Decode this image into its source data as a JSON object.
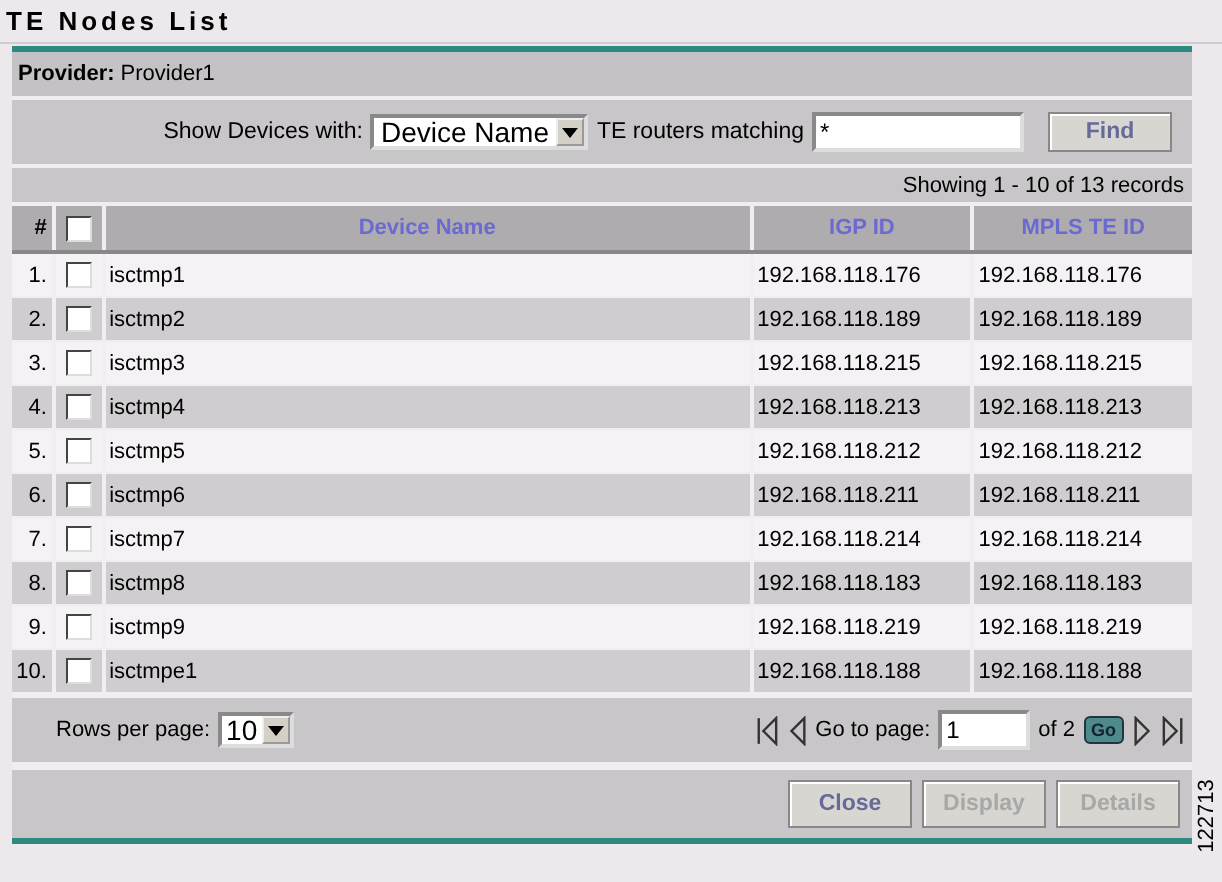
{
  "title": "TE Nodes List",
  "provider": {
    "label": "Provider:",
    "value": "Provider1"
  },
  "filter": {
    "label": "Show Devices with:",
    "select": "Device Name",
    "match_label": "TE routers matching",
    "match_value": "*",
    "button": "Find"
  },
  "records": "Showing 1 - 10 of 13 records",
  "table": {
    "columns": [
      "#",
      "Device Name",
      "IGP ID",
      "MPLS TE ID"
    ],
    "all_checked": false,
    "rows": [
      {
        "num": "1.",
        "checked": false,
        "name": "isctmp1",
        "igp": "192.168.118.176",
        "mpls": "192.168.118.176"
      },
      {
        "num": "2.",
        "checked": false,
        "name": "isctmp2",
        "igp": "192.168.118.189",
        "mpls": "192.168.118.189"
      },
      {
        "num": "3.",
        "checked": false,
        "name": "isctmp3",
        "igp": "192.168.118.215",
        "mpls": "192.168.118.215"
      },
      {
        "num": "4.",
        "checked": false,
        "name": "isctmp4",
        "igp": "192.168.118.213",
        "mpls": "192.168.118.213"
      },
      {
        "num": "5.",
        "checked": false,
        "name": "isctmp5",
        "igp": "192.168.118.212",
        "mpls": "192.168.118.212"
      },
      {
        "num": "6.",
        "checked": false,
        "name": "isctmp6",
        "igp": "192.168.118.211",
        "mpls": "192.168.118.211"
      },
      {
        "num": "7.",
        "checked": false,
        "name": "isctmp7",
        "igp": "192.168.118.214",
        "mpls": "192.168.118.214"
      },
      {
        "num": "8.",
        "checked": false,
        "name": "isctmp8",
        "igp": "192.168.118.183",
        "mpls": "192.168.118.183"
      },
      {
        "num": "9.",
        "checked": false,
        "name": "isctmp9",
        "igp": "192.168.118.219",
        "mpls": "192.168.118.219"
      },
      {
        "num": "10.",
        "checked": false,
        "name": "isctmpe1",
        "igp": "192.168.118.188",
        "mpls": "192.168.118.188"
      }
    ]
  },
  "pagination": {
    "rows_label": "Rows per page:",
    "rows_value": "10",
    "goto_label": "Go to page:",
    "page": "1",
    "of": "of 2",
    "go": "Go"
  },
  "buttons": [
    {
      "label": "Close",
      "disabled": false
    },
    {
      "label": "Display",
      "disabled": true
    },
    {
      "label": "Details",
      "disabled": true
    }
  ],
  "figure_id": "122713"
}
